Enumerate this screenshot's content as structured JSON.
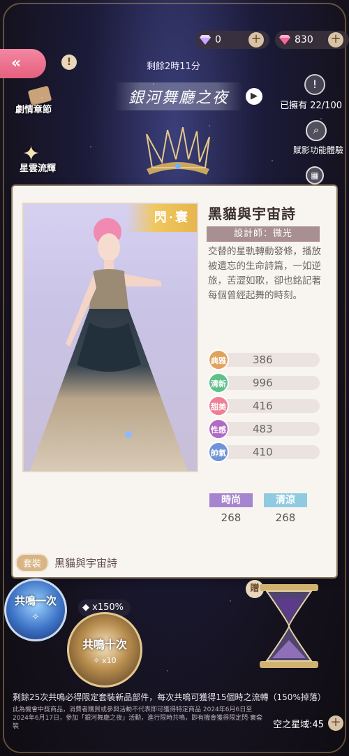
{
  "currencies": [
    {
      "icon": "purple-diamond-icon",
      "value": "0"
    },
    {
      "icon": "pink-diamond-icon",
      "value": "830"
    }
  ],
  "header": {
    "countdown": "剩餘2時11分",
    "event_title": "銀河舞廳之夜",
    "owned": "已擁有 22/100",
    "feature_label": "賦影功能體驗",
    "chapter_label": "劇情章節",
    "star_banner_label": "星雲流輝"
  },
  "card": {
    "rarity_tag": "閃·寰",
    "outfit_name": "黑貓與宇宙詩",
    "designer": "設計師：微光",
    "description": "交替的星軌轉動發條，播放被遺忘的生命詩篇，一如逆旅，苦澀如歌，卻也銘記著每個曾經起舞的時刻。",
    "stats": [
      {
        "label": "典雅",
        "value": "386",
        "color": "#e0a35f"
      },
      {
        "label": "清新",
        "value": "996",
        "color": "#5fc08a"
      },
      {
        "label": "甜美",
        "value": "416",
        "color": "#ef7f95"
      },
      {
        "label": "性感",
        "value": "483",
        "color": "#b16bc3"
      },
      {
        "label": "帥氣",
        "value": "410",
        "color": "#6f93d8"
      }
    ],
    "tags": [
      {
        "label": "時尚",
        "value": "268",
        "color": "#a585cf"
      },
      {
        "label": "清涼",
        "value": "268",
        "color": "#8fcbe0"
      }
    ],
    "suit_tag": "套裝",
    "suit_name": "黑貓與宇宙詩"
  },
  "bottom": {
    "once_label": "共鳴一次",
    "boost": "x150%",
    "ten_label": "共鳴十次",
    "ten_cost": "x10",
    "gift_label": "贈",
    "notice": "剩餘25次共鳴必得限定套裝新品部件，每次共鳴可獲得15個時之流轉（150%掉落）",
    "fine_print": "此為機會中獎商品，消費者購買或參與活動不代表即可獲得特定商品 2024年6月6日至2024年6月17日，參加「銀河舞廳之夜」活動，進行限時共鳴，即有機會獲得限定閃·寰套裝",
    "domain": "空之星域:45"
  }
}
